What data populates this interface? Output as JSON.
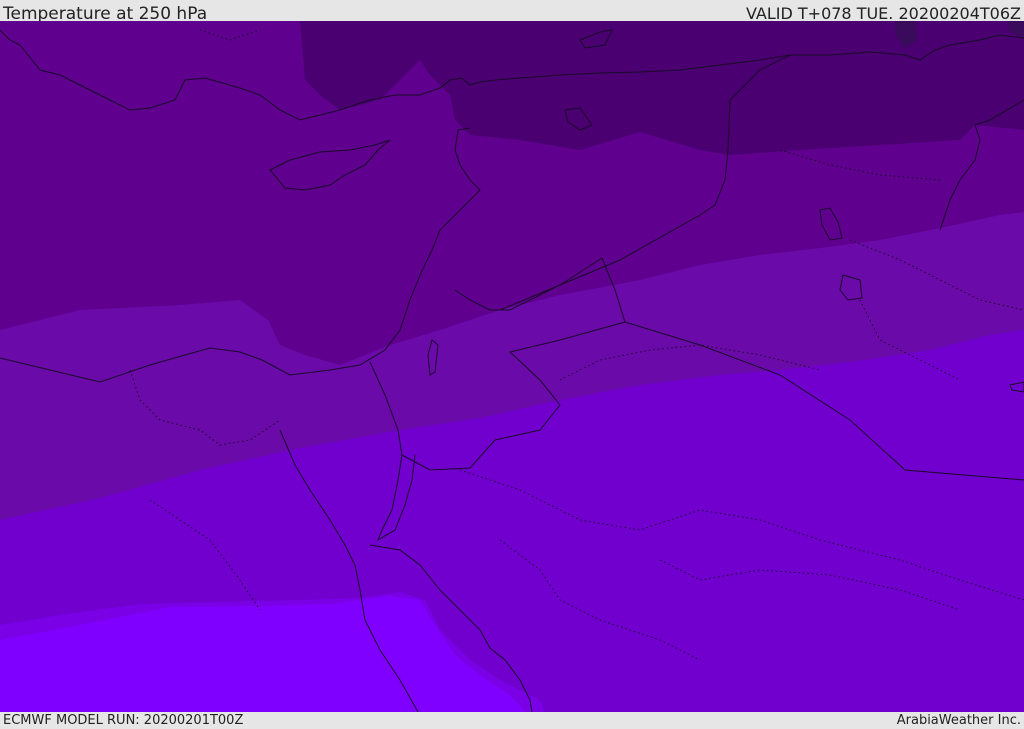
{
  "header": {
    "title": "Temperature at 250 hPa",
    "valid": "VALID T+078 TUE. 20200204T06Z"
  },
  "footer": {
    "model_run": "ECMWF MODEL RUN: 20200201T00Z",
    "credit": "ArabiaWeather Inc."
  },
  "colors": {
    "coldest": "#3a0a5c",
    "very_cold": "#4a0070",
    "cold": "#5f008e",
    "cool": "#6a0aa8",
    "mild": "#7100cf",
    "warm": "#7a00e6",
    "warmest": "#8000ff",
    "coastline": "#1a0a2a"
  }
}
